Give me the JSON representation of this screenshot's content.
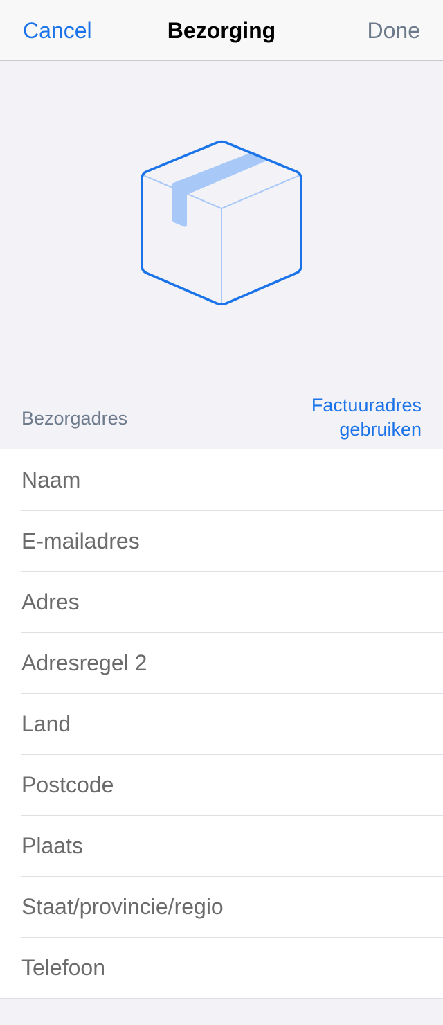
{
  "nav": {
    "cancel_label": "Cancel",
    "title": "Bezorging",
    "done_label": "Done"
  },
  "hero": {
    "icon": "package-box-icon"
  },
  "section": {
    "title": "Bezorgadres",
    "action_label": "Factuuradres gebruiken"
  },
  "form": {
    "fields": [
      {
        "placeholder": "Naam",
        "value": ""
      },
      {
        "placeholder": "E-mailadres",
        "value": ""
      },
      {
        "placeholder": "Adres",
        "value": ""
      },
      {
        "placeholder": "Adresregel 2",
        "value": ""
      },
      {
        "placeholder": "Land",
        "value": ""
      },
      {
        "placeholder": "Postcode",
        "value": ""
      },
      {
        "placeholder": "Plaats",
        "value": ""
      },
      {
        "placeholder": "Staat/provincie/regio",
        "value": ""
      },
      {
        "placeholder": "Telefoon",
        "value": ""
      }
    ]
  },
  "colors": {
    "accent": "#1a73e8",
    "accent_light": "#a8c8f8",
    "muted_text": "#6d7a8c",
    "background": "#f2f2f7"
  }
}
